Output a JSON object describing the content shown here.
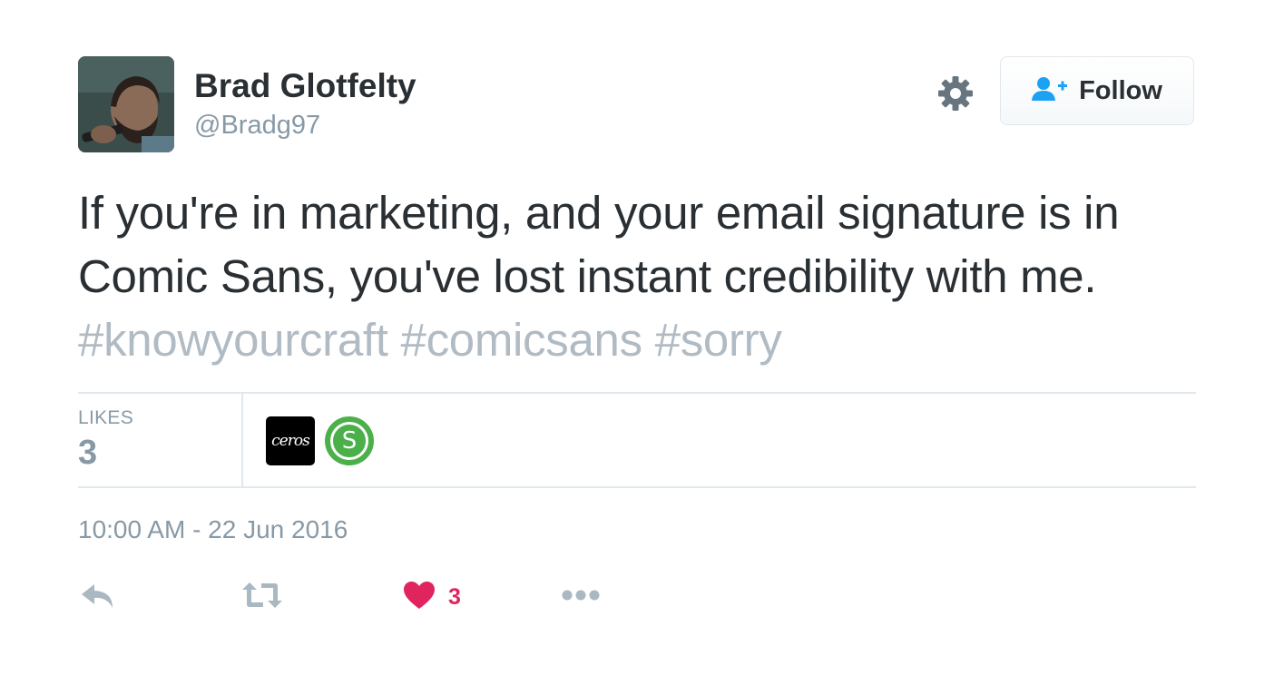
{
  "user": {
    "name": "Brad Glotfelty",
    "handle": "@Bradg97"
  },
  "follow_button": {
    "label": "Follow"
  },
  "tweet": {
    "text": "If you're in marketing, and your email signature is in Comic Sans, you've lost instant credibility with me.",
    "hashtags": [
      "#knowyourcraft",
      "#comicsans",
      "#sorry"
    ]
  },
  "stats": {
    "likes_label": "LIKES",
    "likes_count": "3"
  },
  "likers": [
    {
      "label": "ceros"
    },
    {
      "label": "S"
    }
  ],
  "timestamp": "10:00 AM - 22 Jun 2016",
  "actions": {
    "like_count": "3"
  },
  "colors": {
    "text": "#292f33",
    "muted": "#8899a6",
    "hashtag": "#b1bbc4",
    "like": "#e0245e",
    "follow_icon": "#1da1f2",
    "liker_green": "#4bb04a"
  },
  "icons": [
    "settings-gear-icon",
    "follow-user-icon",
    "reply-icon",
    "retweet-icon",
    "heart-icon",
    "more-icon"
  ]
}
